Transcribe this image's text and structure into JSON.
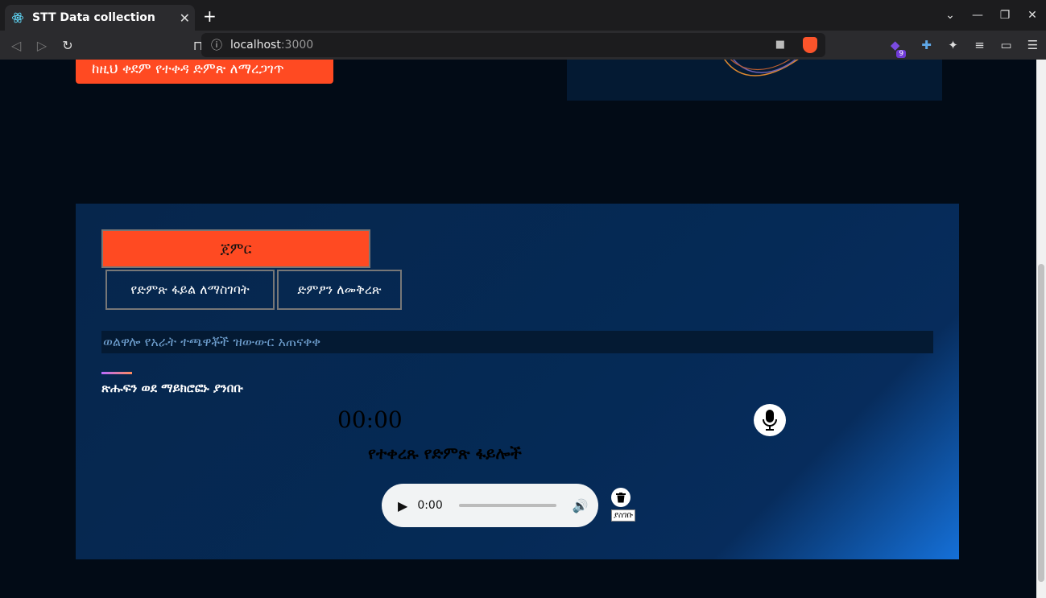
{
  "browser": {
    "tab_title": "STT Data collection",
    "tab_close": "✕",
    "new_tab": "+",
    "url_host": "localhost",
    "url_port": ":3000",
    "extension_badge": "9",
    "window_controls": [
      "⌄",
      "—",
      "❐",
      "✕"
    ]
  },
  "page": {
    "check_previous_button": "ከዚህ ቀደም የተቀዳ ድምጽ ለማረጋገጥ",
    "start_button": "ጀምር",
    "tabs": [
      {
        "label": "የድምጽ ፋይል ለማስገባት"
      },
      {
        "label": "ድምፆን ለመቅረጽ"
      }
    ],
    "prompt_text": "ወልዋሎ የአራት ተጫዋቾች ዝውውር አጠናቀቀ",
    "instruction": "ጽሑፍን ወደ ማይክሮፎኑ ያንበቡ",
    "timer": "00:00",
    "recordings_title": "የተቀረጹ የድምጽ ፋይሎች",
    "audio": {
      "time": "0:00",
      "progress": 0
    },
    "delete_tooltip": "ያስገቡ"
  },
  "colors": {
    "accent": "#ff4a22",
    "panel": "#06264c",
    "background": "#020b16"
  }
}
